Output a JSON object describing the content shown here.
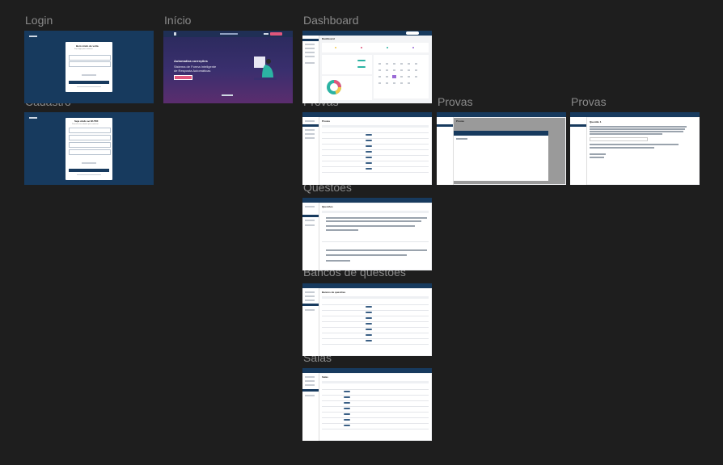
{
  "frames": {
    "login": "Login",
    "inicio": "Início",
    "dashboard": "Dashboard",
    "cadastro": "Cadastro",
    "provas_1": "Provas",
    "provas_2": "Provas",
    "provas_3": "Provas",
    "questoes": "Questões",
    "bancos": "Bancos de questões",
    "salas": "Salas"
  },
  "login_card": {
    "title": "Bem vindo de volta",
    "subtitle": "Faça login para continuar"
  },
  "cadastro_card": {
    "title": "Seja vindo ao NUTRI",
    "subtitle": "Preencha seus dados para continuar"
  },
  "inicio": {
    "headline": "Automatiza correções",
    "subline1": "Sistema de Forma Inteligente",
    "subline2": "de Resposta Automáticas"
  },
  "app_titles": {
    "dashboard": "Dashboard",
    "provas": "Provas",
    "questoes": "Questões",
    "bancos": "Bancos de questões",
    "salas": "Salas",
    "questao": "Questão 1"
  },
  "colors": {
    "canvas": "#1e1e1e",
    "label": "#8a8a8a",
    "navy": "#173a5e",
    "accent_teal": "#2bb3a3",
    "accent_pink": "#e0567c"
  }
}
